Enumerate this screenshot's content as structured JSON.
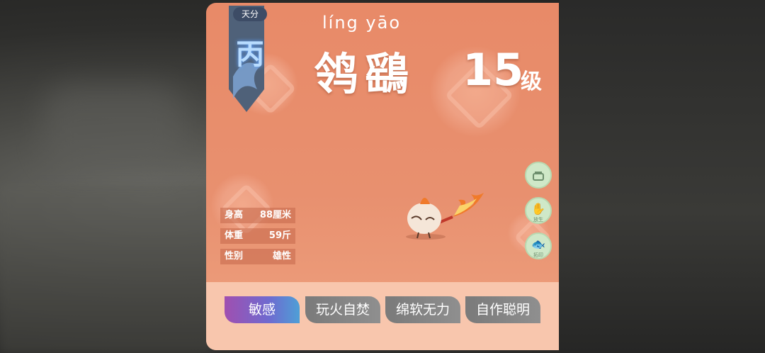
{
  "card": {
    "talent_label": "天分",
    "talent_grade": "丙",
    "pinyin": "líng yāo",
    "name": "鸰鷂",
    "level_number": "15",
    "level_unit": "级"
  },
  "side_buttons": [
    {
      "icon": "lock-icon",
      "label": ""
    },
    {
      "icon": "release-icon",
      "label": "放生"
    },
    {
      "icon": "rubbing-icon",
      "label": "拓印"
    }
  ],
  "stats": [
    {
      "key": "身高",
      "value": "88厘米"
    },
    {
      "key": "体重",
      "value": "59斤"
    },
    {
      "key": "性别",
      "value": "雄性"
    }
  ],
  "traits": [
    "敏感",
    "玩火自焚",
    "绵软无力",
    "自作聪明"
  ]
}
